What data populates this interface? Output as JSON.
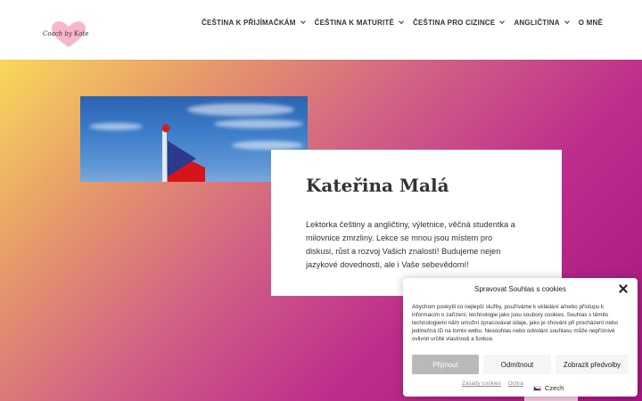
{
  "header": {
    "logo_text": "Coach by Kate",
    "nav": [
      {
        "label": "ČEŠTINA K PŘIJÍMAČKÁM",
        "has_dropdown": true
      },
      {
        "label": "ČEŠTINA K MATURITĚ",
        "has_dropdown": true
      },
      {
        "label": "ČEŠTINA PRO CIZINCE",
        "has_dropdown": true
      },
      {
        "label": "ANGLIČTINA",
        "has_dropdown": true
      },
      {
        "label": "O MNĚ",
        "has_dropdown": false
      }
    ]
  },
  "hero": {
    "photo_description_icon": "flag-on-pole-photo",
    "card_title": "Kateřina Malá",
    "card_text": "Lektorka češtiny a angličtiny, výletnice, věčná studentka a milovnice zmrzliny. Lekce se mnou jsou místem pro diskusi, růst a rozvoj Vašich znalostí! Budujeme nejen jazykové dovednosti, ale i Vaše sebevědomí!"
  },
  "cookie": {
    "title": "Spravovat Souhlas s cookies",
    "text": "Abychom poskytli co nejlepší služby, používáme k ukládání a/nebo přístupu k informacím o zařízení, technologie jako jsou soubory cookies. Souhlas s těmito technologiemi nám umožní zpracovávat údaje, jako je chování při procházení nebo jedinečná ID na tomto webu. Nesouhlas nebo odvolání souhlasu může nepříznivě ovlivnit určité vlastnosti a funkce.",
    "accept_label": "Přijmout",
    "deny_label": "Odmítnout",
    "preferences_label": "Zobrazit předvolby",
    "links": [
      "Zásady cookies",
      "Ochra"
    ],
    "language": "Czech"
  },
  "colors": {
    "gradient_start": "#f9d85a",
    "gradient_end": "#a3147f",
    "accept_button": "#b9b9ba"
  }
}
